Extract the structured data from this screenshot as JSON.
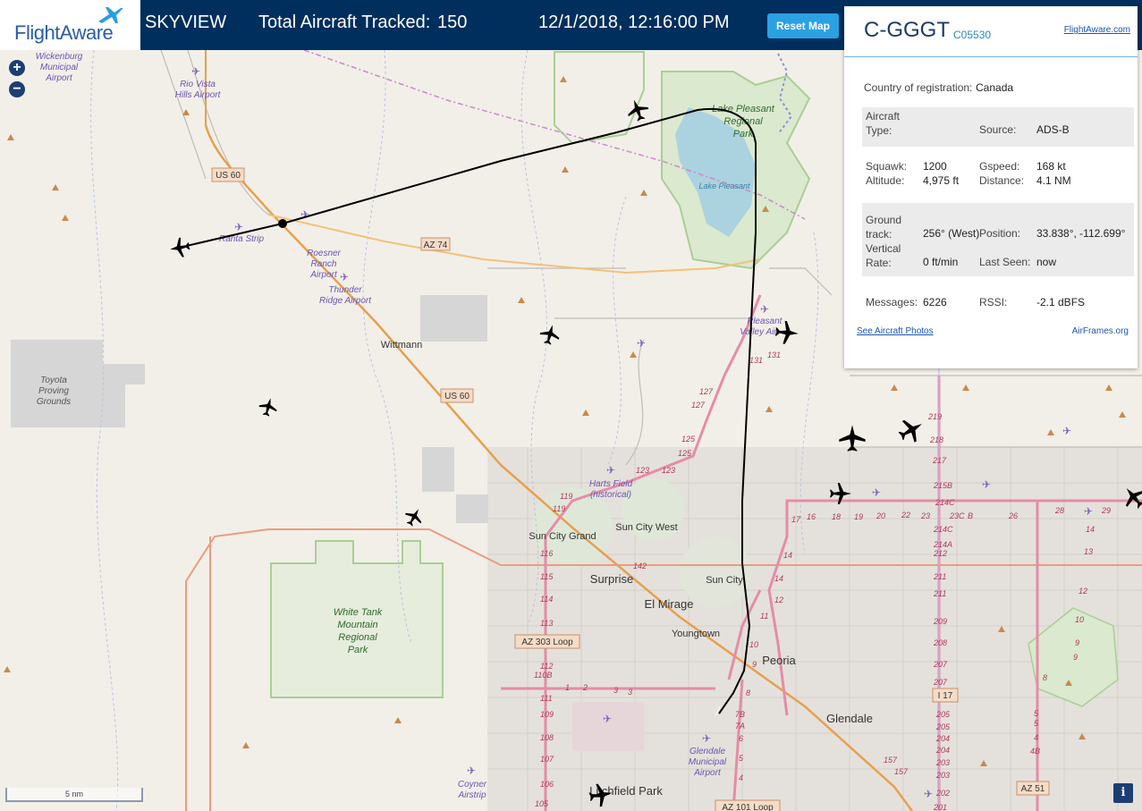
{
  "header": {
    "logo_text": "FlightAware",
    "app_name": "SKYVIEW",
    "tracked_label": "Total Aircraft Tracked:",
    "tracked_count": "150",
    "timestamp": "12/1/2018, 12:16:00 PM",
    "reset_button": "Reset Map"
  },
  "map": {
    "zoom_in": "+",
    "zoom_out": "−",
    "scale_label": "5 nm",
    "info_button": "i",
    "place_labels": [
      "Wickenburg Municipal Airport",
      "Rio Vista Hills Airport",
      "Lake Pleasant Regional Park",
      "Lake Pleasant",
      "Ranta Strip",
      "Roesner Ranch Airport",
      "Thunder Ridge Airport",
      "Wittmann",
      "Toyota Proving Grounds",
      "Pleasant Valley Airport",
      "Harts Field (historical)",
      "Sun City Grand",
      "Sun City West",
      "Surprise",
      "Sun City",
      "El Mirage",
      "Youngtown",
      "Peoria",
      "Glendale",
      "White Tank Mountain Regional Park",
      "Glendale Municipal Airport",
      "Coyner Airstrip",
      "Litchfield Park"
    ],
    "road_shields": [
      "US 60",
      "AZ 74",
      "US 60",
      "AZ 303 Loop",
      "I 17",
      "AZ 101 Loop",
      "AZ 51"
    ],
    "road_numbers": [
      "131",
      "127",
      "125",
      "123",
      "119",
      "116",
      "115",
      "114",
      "113",
      "112",
      "110B",
      "111",
      "109",
      "108",
      "107",
      "106",
      "105",
      "142",
      "17",
      "16",
      "18",
      "19",
      "20",
      "22",
      "23",
      "23C",
      "B",
      "26",
      "28",
      "29",
      "219",
      "218",
      "217",
      "215B",
      "214C",
      "214A",
      "212",
      "211",
      "210",
      "209",
      "208",
      "207",
      "206",
      "205",
      "204",
      "203",
      "202",
      "201",
      "14",
      "13",
      "12",
      "11",
      "10",
      "9",
      "8",
      "7B",
      "7A",
      "6",
      "5",
      "4",
      "1",
      "2",
      "3",
      "157"
    ],
    "colors": {
      "land": "#f2efe9",
      "water": "#aad3df",
      "park": "#cfe6c3",
      "track": "#000000",
      "header": "#002f5d",
      "accent": "#2aa1e3"
    }
  },
  "panel": {
    "callsign": "C-GGGT",
    "hexcode": "C05530",
    "fa_link": "FlightAware.com",
    "country_label": "Country of registration:",
    "country_value": "Canada",
    "aircraft_type_label": "Aircraft Type:",
    "aircraft_type_value": "",
    "source_label": "Source:",
    "source_value": "ADS-B",
    "squawk_label": "Squawk:",
    "squawk_value": "1200",
    "gspeed_label": "Gspeed:",
    "gspeed_value": "168 kt",
    "altitude_label": "Altitude:",
    "altitude_value": "4,975 ft",
    "distance_label": "Distance:",
    "distance_value": "4.1 NM",
    "ground_track_label": "Ground track:",
    "ground_track_value": "256° (West)",
    "position_label": "Position:",
    "position_value": "33.838°, -112.699°",
    "vertical_rate_label": "Vertical Rate:",
    "vertical_rate_value": "0 ft/min",
    "last_seen_label": "Last Seen:",
    "last_seen_value": "now",
    "messages_label": "Messages:",
    "messages_value": "6226",
    "rssi_label": "RSSI:",
    "rssi_value": "-2.1 dBFS",
    "photos_link": "See Aircraft Photos",
    "airframes_link": "AirFrames.org"
  }
}
